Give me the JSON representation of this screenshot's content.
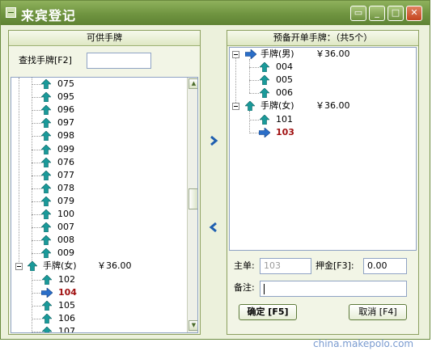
{
  "window": {
    "title": "来宾登记",
    "controls": {
      "restore": "▭",
      "minimize": "_",
      "maximize": "□",
      "close": "✕"
    }
  },
  "left_panel": {
    "header": "可供手牌",
    "search_label": "查找手牌[F2]",
    "search_value": "",
    "items": [
      "075",
      "095",
      "096",
      "097",
      "098",
      "099",
      "076",
      "077",
      "078",
      "079",
      "100",
      "007",
      "008",
      "009"
    ],
    "female_group": {
      "label": "手牌(女)",
      "price": "￥36.00"
    },
    "female_items": [
      {
        "label": "102",
        "selected": false
      },
      {
        "label": "104",
        "selected": true
      },
      {
        "label": "105",
        "selected": false
      },
      {
        "label": "106",
        "selected": false
      },
      {
        "label": "107",
        "selected": false
      }
    ]
  },
  "right_panel": {
    "header": "预备开单手牌：（共5个）",
    "groups": [
      {
        "label": "手牌(男)",
        "price": "￥36.00",
        "items": [
          {
            "label": "004",
            "selected": false
          },
          {
            "label": "005",
            "selected": false
          },
          {
            "label": "006",
            "selected": false
          }
        ]
      },
      {
        "label": "手牌(女)",
        "price": "￥36.00",
        "items": [
          {
            "label": "101",
            "selected": false
          },
          {
            "label": "103",
            "selected": true
          }
        ]
      }
    ]
  },
  "form": {
    "main_label": "主单:",
    "main_value": "103",
    "deposit_label": "押金[F3]:",
    "deposit_value": "0.00",
    "note_label": "备注:",
    "note_value": ""
  },
  "buttons": {
    "ok": "确定 [F5]",
    "cancel": "取消 [F4]",
    "move_right": "›",
    "move_left": "‹"
  },
  "watermark": "china.makepolo.com",
  "colors": {
    "title_bar": "#6f9440",
    "selected_text": "#a01010",
    "up_arrow": "#1a9a9a",
    "right_arrow": "#2a6ec8",
    "move_arrow": "#1f5fb0"
  }
}
